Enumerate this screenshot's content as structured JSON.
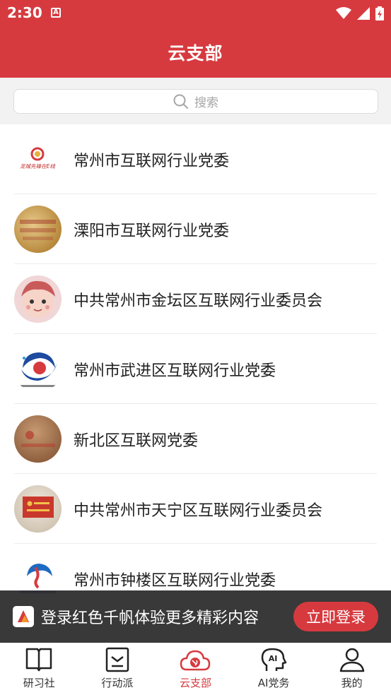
{
  "status_bar": {
    "time": "2:30",
    "notification_icon": "A"
  },
  "header": {
    "title": "云支部"
  },
  "search": {
    "placeholder": "搜索"
  },
  "list": [
    {
      "name": "常州市互联网行业党委",
      "logo_text": "龙城先锋在E线"
    },
    {
      "name": "溧阳市互联网行业党委"
    },
    {
      "name": "中共常州市金坛区互联网行业委员会"
    },
    {
      "name": "常州市武进区互联网行业党委"
    },
    {
      "name": "新北区互联网党委"
    },
    {
      "name": "中共常州市天宁区互联网行业委员会"
    },
    {
      "name": "常州市钟楼区互联网行业党委"
    }
  ],
  "login_banner": {
    "text": "登录红色千帆体验更多精彩内容",
    "button": "立即登录"
  },
  "bottom_nav": [
    {
      "label": "研习社",
      "icon": "book-icon",
      "active": false
    },
    {
      "label": "行动派",
      "icon": "flag-bookmark-icon",
      "active": false
    },
    {
      "label": "云支部",
      "icon": "cloud-party-icon",
      "active": true
    },
    {
      "label": "AI党务",
      "icon": "ai-head-icon",
      "active": false
    },
    {
      "label": "我的",
      "icon": "user-icon",
      "active": false
    }
  ],
  "colors": {
    "brand_red": "#d63a3f",
    "banner_bg": "#2a2a2a"
  }
}
